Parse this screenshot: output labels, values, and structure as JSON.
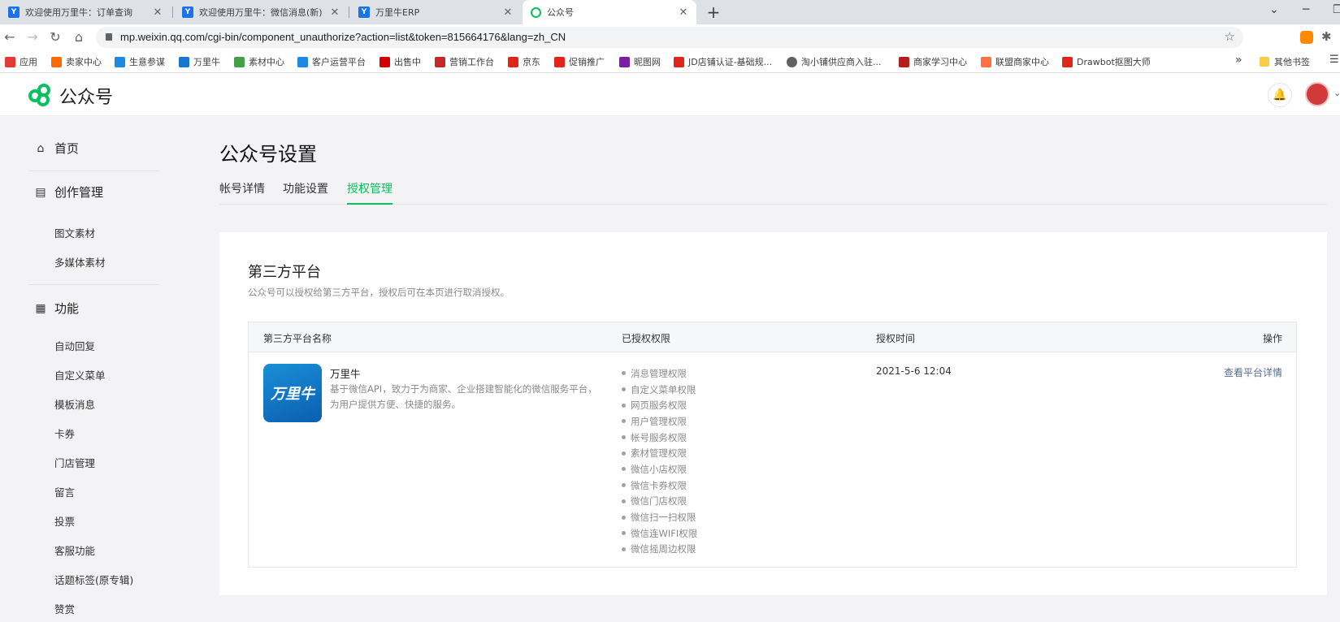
{
  "browser": {
    "tabs": [
      {
        "title": "欢迎使用万里牛：订单查询",
        "icon": "wanliniu-favicon"
      },
      {
        "title": "欢迎使用万里牛：微信消息(新)",
        "icon": "wanliniu-favicon"
      },
      {
        "title": "万里牛ERP",
        "icon": "wanliniu-favicon"
      },
      {
        "title": "公众号",
        "icon": "wechat-favicon"
      }
    ],
    "active_tab": 3,
    "url": "mp.weixin.qq.com/cgi-bin/component_unauthorize?action=list&token=815664176&lang=zh_CN",
    "bookmarks": [
      {
        "label": "应用",
        "color": "#e53935"
      },
      {
        "label": "卖家中心",
        "color": "#ff6a00"
      },
      {
        "label": "生意参谋",
        "color": "#1e88e5"
      },
      {
        "label": "万里牛",
        "color": "#1976d2"
      },
      {
        "label": "素材中心",
        "color": "#43a047"
      },
      {
        "label": "客户运营平台",
        "color": "#1e88e5"
      },
      {
        "label": "出售中",
        "color": "#d50000"
      },
      {
        "label": "营销工作台",
        "color": "#c62828"
      },
      {
        "label": "京东",
        "color": "#e1251b"
      },
      {
        "label": "促销推广",
        "color": "#e1251b"
      },
      {
        "label": "昵图网",
        "color": "#7b1fa2"
      },
      {
        "label": "JD店铺认证-基础规...",
        "color": "#e1251b"
      },
      {
        "label": "淘小铺供应商入驻...",
        "color": "#616161"
      },
      {
        "label": "商家学习中心",
        "color": "#b71c1c"
      },
      {
        "label": "联盟商家中心",
        "color": "#ff7043"
      },
      {
        "label": "Drawbot抠图大师",
        "color": "#e1251b"
      }
    ],
    "bookmarks_more": "»",
    "other_bookmarks": "其他书签"
  },
  "header": {
    "logo_text": "公众号"
  },
  "sidebar": {
    "groups": [
      {
        "label": "首页",
        "icon": "home-icon",
        "items": []
      },
      {
        "label": "创作管理",
        "icon": "document-icon",
        "items": [
          "图文素材",
          "多媒体素材"
        ]
      },
      {
        "label": "功能",
        "icon": "grid-icon",
        "items": [
          "自动回复",
          "自定义菜单",
          "模板消息",
          "卡券",
          "门店管理",
          "留言",
          "投票",
          "客服功能",
          "话题标签(原专辑)",
          "赞赏"
        ]
      }
    ]
  },
  "main": {
    "title": "公众号设置",
    "tabs": [
      "帐号详情",
      "功能设置",
      "授权管理"
    ],
    "active_tab": 2,
    "section_title": "第三方平台",
    "section_desc": "公众号可以授权给第三方平台，授权后可在本页进行取消授权。",
    "table": {
      "headers": [
        "第三方平台名称",
        "已授权权限",
        "授权时间",
        "操作"
      ],
      "rows": [
        {
          "logo_text": "万里牛",
          "name": "万里牛",
          "desc": "基于微信API，致力于为商家、企业搭建智能化的微信服务平台，为用户提供方便、快捷的服务。",
          "permissions": [
            "消息管理权限",
            "自定义菜单权限",
            "网页服务权限",
            "用户管理权限",
            "帐号服务权限",
            "素材管理权限",
            "微信小店权限",
            "微信卡券权限",
            "微信门店权限",
            "微信扫一扫权限",
            "微信连WIFI权限",
            "微信摇周边权限"
          ],
          "auth_time": "2021-5-6 12:04",
          "action": "查看平台详情"
        }
      ]
    }
  },
  "colors": {
    "accent": "#07c160",
    "link": "#576b95"
  }
}
